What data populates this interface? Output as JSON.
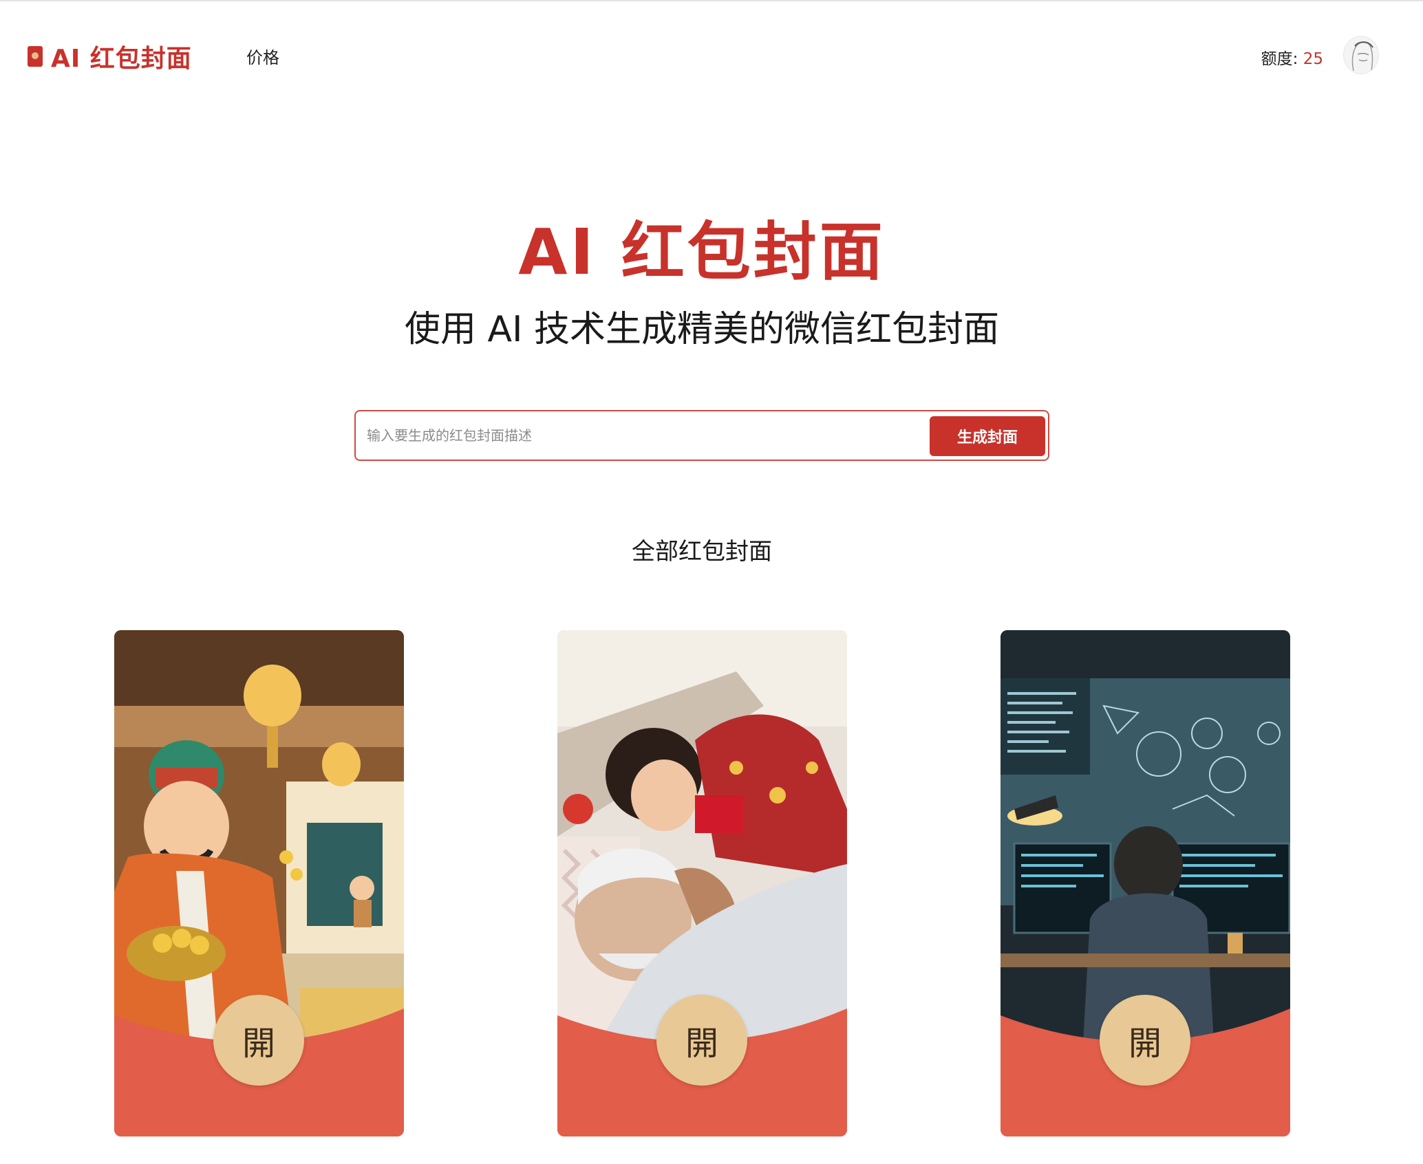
{
  "header": {
    "brand": "AI 红包封面",
    "nav_price": "价格",
    "quota_label": "额度: ",
    "quota_value": "25"
  },
  "hero": {
    "title": "AI 红包封面",
    "subtitle": "使用 AI 技术生成精美的微信红包封面"
  },
  "search": {
    "placeholder": "输入要生成的红包封面描述",
    "button_label": "生成封面"
  },
  "section": {
    "title": "全部红包封面"
  },
  "cards": [
    {
      "open_label": "開"
    },
    {
      "open_label": "開"
    },
    {
      "open_label": "開"
    }
  ],
  "colors": {
    "brand": "#c8322b",
    "card_bottom": "#e25d4a",
    "open_button": "#e8c894"
  },
  "icons": {
    "brand": "red-envelope-icon",
    "avatar": "user-avatar"
  }
}
